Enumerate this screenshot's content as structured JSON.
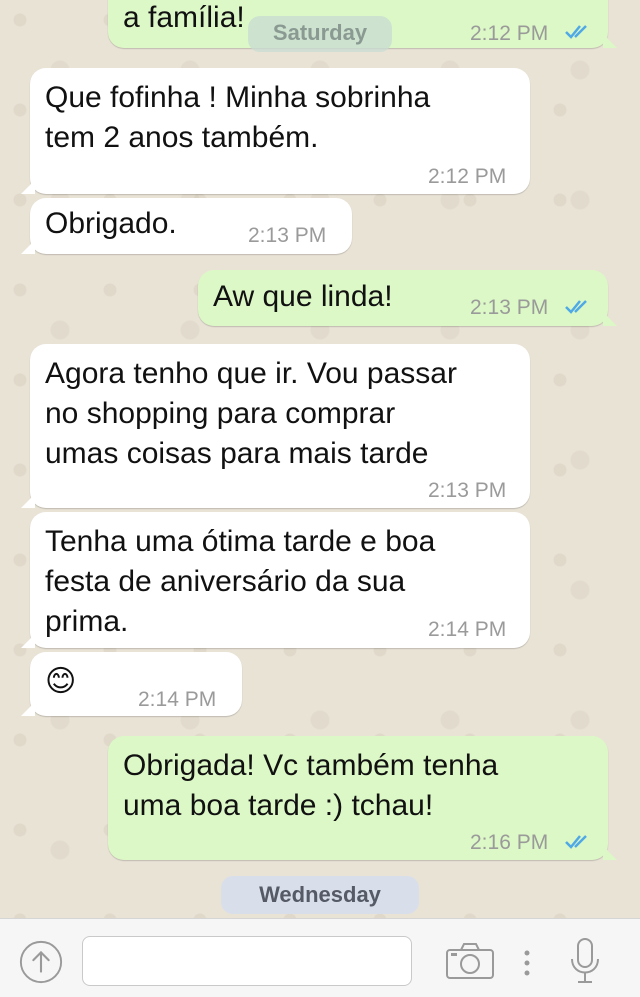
{
  "colors": {
    "incoming_bubble": "#ffffff",
    "outgoing_bubble": "#dcf8c6",
    "read_ticks": "#4fa9e6",
    "timestamp": "#9a9a9a"
  },
  "date_separators": {
    "top": "Saturday",
    "bottom": "Wednesday"
  },
  "messages": [
    {
      "direction": "out",
      "text": "a família!",
      "time": "2:12 PM",
      "status_icon": "double-check-read-icon"
    },
    {
      "direction": "in",
      "text": "Que fofinha ! Minha sobrinha\ntem 2 anos também.",
      "time": "2:12 PM"
    },
    {
      "direction": "in",
      "text": "Obrigado.",
      "time": "2:13 PM"
    },
    {
      "direction": "out",
      "text": "Aw que linda!",
      "time": "2:13 PM",
      "status_icon": "double-check-read-icon"
    },
    {
      "direction": "in",
      "text": "Agora tenho que ir. Vou passar\nno shopping para comprar\numas coisas para mais tarde",
      "time": "2:13 PM"
    },
    {
      "direction": "in",
      "text": "Tenha uma ótima tarde e boa\nfesta de aniversário da sua\nprima.",
      "time": "2:14 PM"
    },
    {
      "direction": "in",
      "text": "😊",
      "time": "2:14 PM",
      "emoji_icon": "smiling-face-emoji-icon"
    },
    {
      "direction": "out",
      "text": "Obrigada! Vc também tenha\numa boa tarde :) tchau!",
      "time": "2:16 PM",
      "status_icon": "double-check-read-icon"
    }
  ],
  "input_bar": {
    "left_icon": "share-up-arrow-icon",
    "placeholder": "",
    "value": "",
    "icons": [
      "camera-icon",
      "more-vertical-icon",
      "microphone-icon"
    ]
  }
}
